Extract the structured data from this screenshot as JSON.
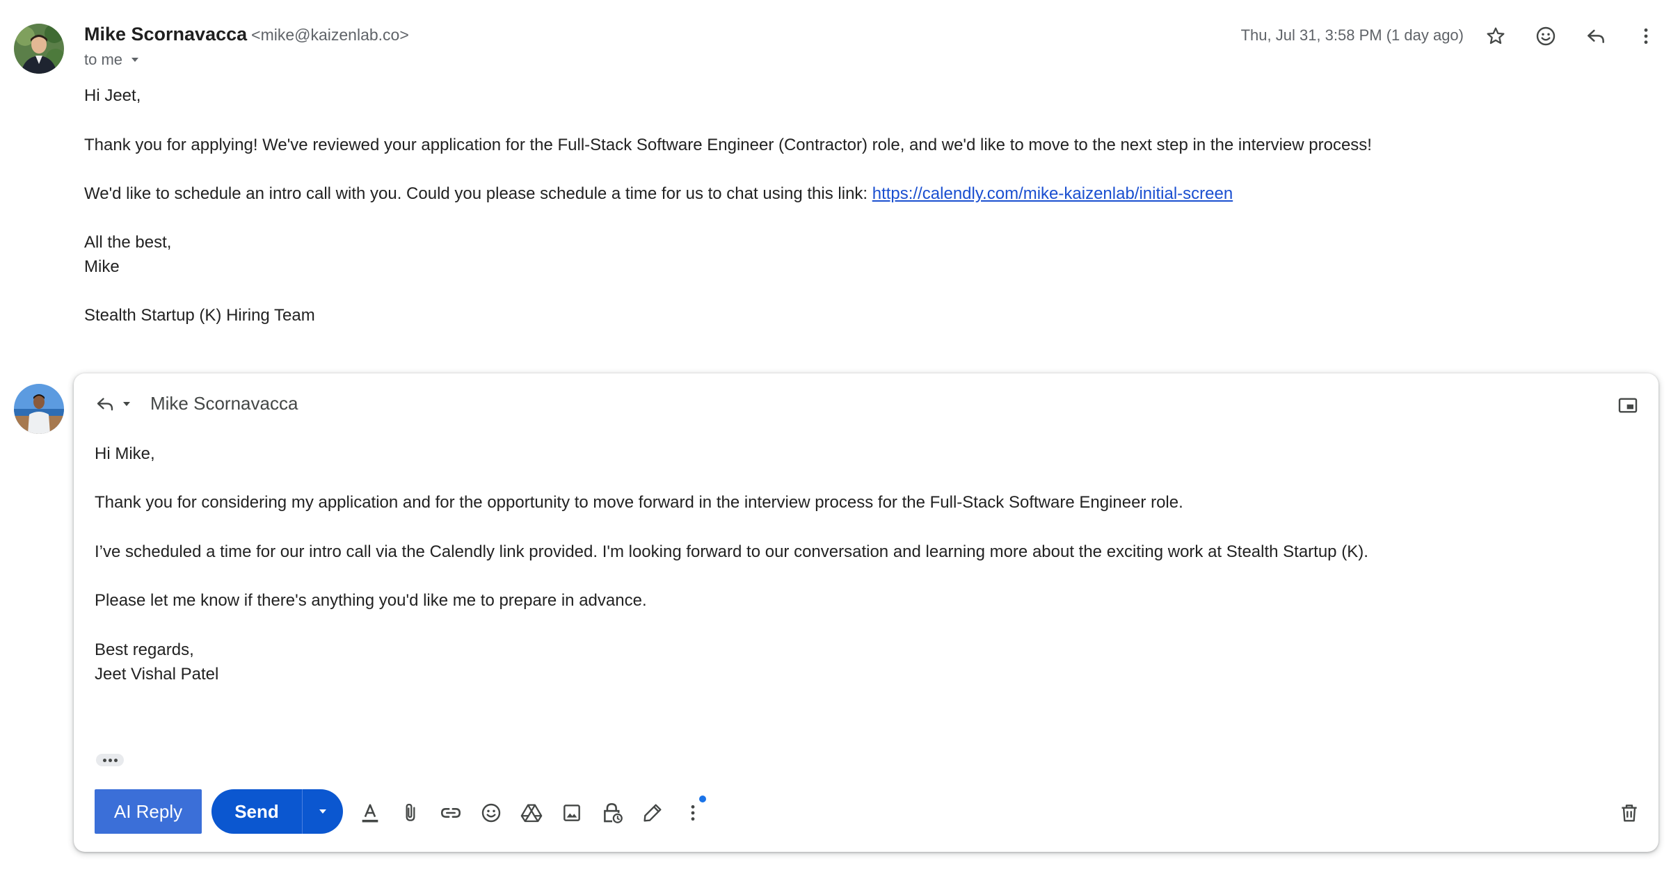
{
  "message": {
    "sender_name": "Mike Scornavacca",
    "sender_email": "<mike@kaizenlab.co>",
    "to_label": "to me",
    "timestamp": "Thu, Jul 31, 3:58 PM (1 day ago)",
    "body": {
      "greeting": "Hi Jeet,",
      "para1": "Thank you for applying! We've reviewed your application for the Full-Stack Software Engineer (Contractor) role, and we'd like to move to the next step in the interview process!",
      "para2_prefix": "We'd like to schedule an intro call with you. Could you please schedule a time for us to chat using this link: ",
      "link": "https://calendly.com/mike-kaizenlab/initial-screen",
      "closing": "All the best,",
      "signature": "Mike",
      "team": "Stealth Startup (K) Hiring Team"
    }
  },
  "reply": {
    "recipient": "Mike Scornavacca",
    "greeting": "Hi Mike,",
    "para1": "Thank you for considering my application and for the opportunity to move forward in the interview process for the Full-Stack Software Engineer role.",
    "para2": "I’ve scheduled a time for our intro call via the Calendly link provided. I'm looking forward to our conversation and learning more about the exciting work at Stealth Startup (K).",
    "para3": "Please let me know if there's anything you'd like me to prepare in advance.",
    "closing": "Best regards,",
    "signature": "Jeet Vishal Patel"
  },
  "toolbar": {
    "ai_reply_label": "AI Reply",
    "send_label": "Send"
  },
  "colors": {
    "primary": "#0b57d0",
    "ai_button": "#3b6fd8",
    "link": "#1a4fd0",
    "notification_dot": "#1a73e8"
  },
  "icons": [
    "star-icon",
    "emoji-reaction-icon",
    "reply-icon",
    "more-vert-icon",
    "popout-icon",
    "format-text-icon",
    "attach-icon",
    "link-icon",
    "emoji-icon",
    "drive-icon",
    "photo-icon",
    "confidential-icon",
    "signature-icon",
    "more-options-icon",
    "trash-icon"
  ]
}
